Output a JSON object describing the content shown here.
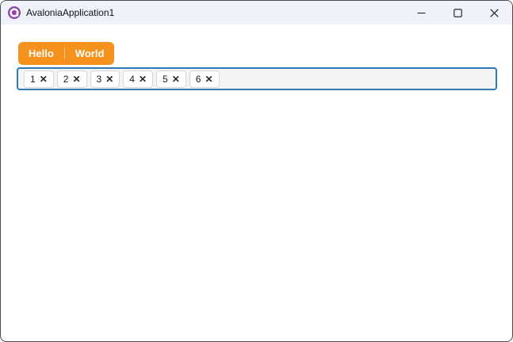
{
  "window": {
    "title": "AvaloniaApplication1",
    "controls": [
      {
        "id": "minimize",
        "label": "Minimize"
      },
      {
        "id": "maximize",
        "label": "Maximize"
      },
      {
        "id": "close",
        "label": "Close"
      }
    ]
  },
  "tab_strip": {
    "tabs": [
      {
        "label": "Hello"
      },
      {
        "label": "World"
      }
    ]
  },
  "tag_box": {
    "chips": [
      {
        "label": "1"
      },
      {
        "label": "2"
      },
      {
        "label": "3"
      },
      {
        "label": "4"
      },
      {
        "label": "5"
      },
      {
        "label": "6"
      }
    ],
    "remove_glyph": "✕"
  },
  "colors": {
    "accent_orange": "#F5921E",
    "focus_blue": "#3079B6",
    "titlebar_bg": "#EFF3F9",
    "logo_purple": "#8B44A8"
  }
}
